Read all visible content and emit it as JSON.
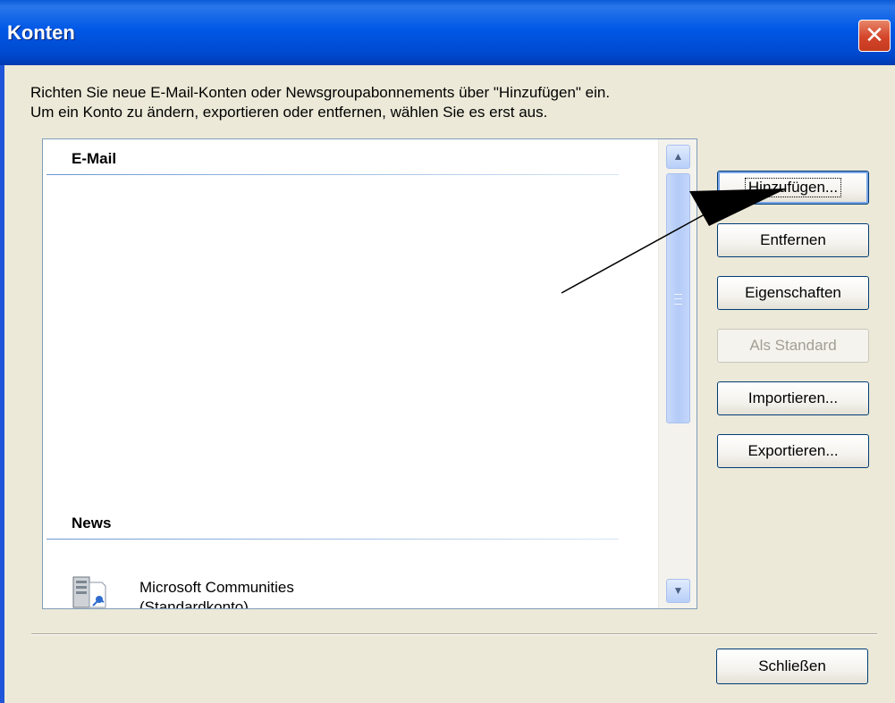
{
  "window": {
    "title": "Konten",
    "close_glyph": "✕"
  },
  "description": {
    "line1": "Richten Sie neue E-Mail-Konten oder Newsgroupabonnements über \"Hinzufügen\" ein.",
    "line2": "Um ein Konto zu ändern, exportieren oder entfernen, wählen Sie es erst aus."
  },
  "account_list": {
    "groups": [
      {
        "header": "E-Mail",
        "accounts": []
      },
      {
        "header": "News",
        "accounts": [
          {
            "name": "Microsoft Communities",
            "subtitle": "(Standardkonto)",
            "icon": "news-server-icon"
          }
        ]
      }
    ],
    "scroll_up_glyph": "▲",
    "scroll_down_glyph": "▼"
  },
  "buttons": {
    "add": {
      "label": "Hinzufügen...",
      "enabled": true
    },
    "remove": {
      "label": "Entfernen",
      "enabled": true
    },
    "properties": {
      "label": "Eigenschaften",
      "enabled": true
    },
    "set_default": {
      "label": "Als Standard",
      "enabled": false
    },
    "import": {
      "label": "Importieren...",
      "enabled": true
    },
    "export": {
      "label": "Exportieren...",
      "enabled": true
    },
    "close": {
      "label": "Schließen",
      "enabled": true
    }
  },
  "annotation": {
    "type": "arrow",
    "points_to": "add-button",
    "color": "#000000"
  },
  "colors": {
    "titlebar": "#0058e6",
    "dialog_bg": "#ece9d8",
    "close_button": "#d4452a",
    "button_border": "#003c74"
  }
}
